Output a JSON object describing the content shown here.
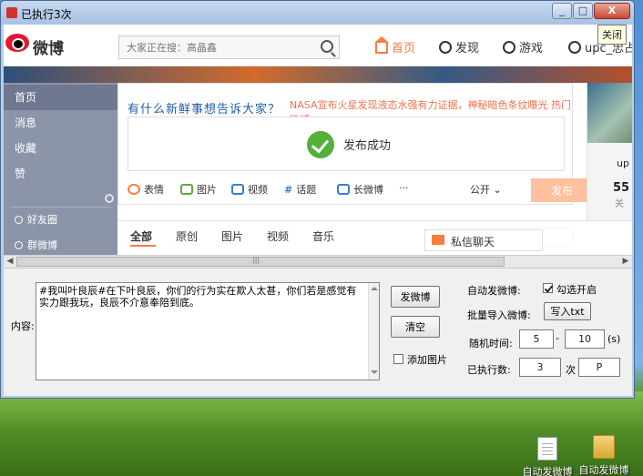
{
  "window": {
    "title": "已执行3次",
    "buttons": {
      "minimize": "_",
      "maximize": "□",
      "close": "X"
    },
    "tooltip": "关闭"
  },
  "weibo": {
    "logo": "微博",
    "search_placeholder": "大家正在搜：高晶鑫",
    "nav": {
      "home": "首页",
      "discover": "发现",
      "game": "游戏",
      "user": "upc_忠占"
    },
    "sidebar": {
      "items": [
        "首页",
        "消息",
        "收藏",
        "赞"
      ],
      "groups": [
        "好友圈",
        "群微博"
      ]
    },
    "composer": {
      "prompt": "有什么新鲜事想告诉大家？",
      "hot_topic": "NASA宣布火星发现液态水强有力证据，神秘暗色条纹曝光  热门微博",
      "success": "发布成功",
      "tools": [
        "表情",
        "图片",
        "视频",
        "话题",
        "长微博",
        "···"
      ],
      "visibility": "公开 ⌄",
      "publish": "发布"
    },
    "feed_tabs": [
      "全部",
      "原创",
      "图片",
      "视频",
      "音乐"
    ],
    "chat": "私信聊天",
    "profile": {
      "short": "up",
      "count": "55",
      "label": "关"
    }
  },
  "scrollbar": {
    "left_arrow": "◀",
    "right_arrow": "▶",
    "thumb_grip": "|||"
  },
  "form": {
    "content_label": "内容:",
    "content_text": "#我叫叶良辰#在下叶良辰，你们的行为实在欺人太甚，你们若是感觉有实力跟我玩，良辰不介意奉陪到底。",
    "post_button": "发微博",
    "clear_button": "清空",
    "add_image_label": "添加图片",
    "auto_post_label": "自动发微博:",
    "auto_post_checkbox": "勾选开启",
    "batch_import_label": "批量导入微博:",
    "import_button": "写入txt",
    "random_time_label": "随机时间:",
    "random_from": "5",
    "dash": "-",
    "random_to": "10",
    "unit_s": "(s)",
    "executed_label": "已执行数:",
    "executed_count": "3",
    "times_label": "次",
    "stop_value": "P"
  },
  "desktop": {
    "icons": [
      "自动发微博",
      "自动发微博"
    ]
  }
}
